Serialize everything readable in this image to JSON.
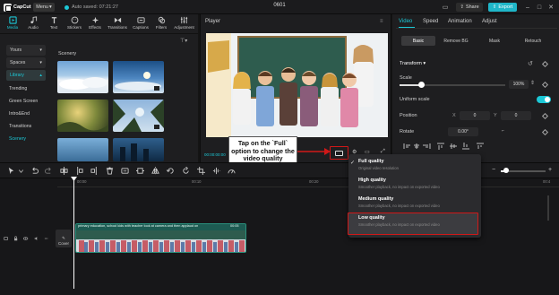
{
  "app": {
    "logo_text": "CapCut",
    "menu_label": "Menu",
    "autosave_text": "Auto saved: 07:21:27",
    "project_title": "0601",
    "share_label": "Share",
    "export_label": "Export"
  },
  "tool_tabs": [
    "Media",
    "Audio",
    "Text",
    "Stickers",
    "Effects",
    "Transitions",
    "Captions",
    "Filters",
    "Adjustment"
  ],
  "sidebar": {
    "items": [
      "Yours",
      "Spaces",
      "Library",
      "Trending",
      "Green Screen",
      "Intro&End",
      "Transitions",
      "Scenery"
    ]
  },
  "library": {
    "section_title": "Scenery"
  },
  "player": {
    "title": "Player",
    "timecode": "00:00:00:00"
  },
  "callout": {
    "text": "Tap on the `Full` option to change the video quality"
  },
  "right_panel": {
    "tabs": [
      "Video",
      "Speed",
      "Animation",
      "Adjust"
    ],
    "subtabs": [
      "Basic",
      "Remove BG",
      "Mask",
      "Retouch"
    ],
    "transform_label": "Transform",
    "scale_label": "Scale",
    "scale_value": "100%",
    "uniform_scale_label": "Uniform scale",
    "position_label": "Position",
    "position_x_label": "X",
    "position_x": "0",
    "position_y_label": "Y",
    "position_y": "0",
    "rotate_label": "Rotate",
    "rotate_value": "0.00°"
  },
  "timeline": {
    "ruler_ticks": [
      "00:00",
      "00:10",
      "00:20",
      "00:30",
      "00:4"
    ],
    "cover_label": "Cover",
    "clip_title": "primary education, school kids with teacher look at camera and then applaud on",
    "clip_duration": "00:05"
  },
  "quality_menu": {
    "options": [
      {
        "title": "Full quality",
        "desc": "Original video resolution",
        "selected": true
      },
      {
        "title": "High quality",
        "desc": "Smoother playback, no impact on exported video",
        "selected": false
      },
      {
        "title": "Medium quality",
        "desc": "Smoother playback, no impact on exported video",
        "selected": false
      },
      {
        "title": "Low quality",
        "desc": "Smoother playback, no impact on exported video",
        "selected": false
      }
    ]
  },
  "colors": {
    "accent": "#1cc8d6",
    "highlight": "#d01818",
    "clip": "#1d5b52"
  }
}
